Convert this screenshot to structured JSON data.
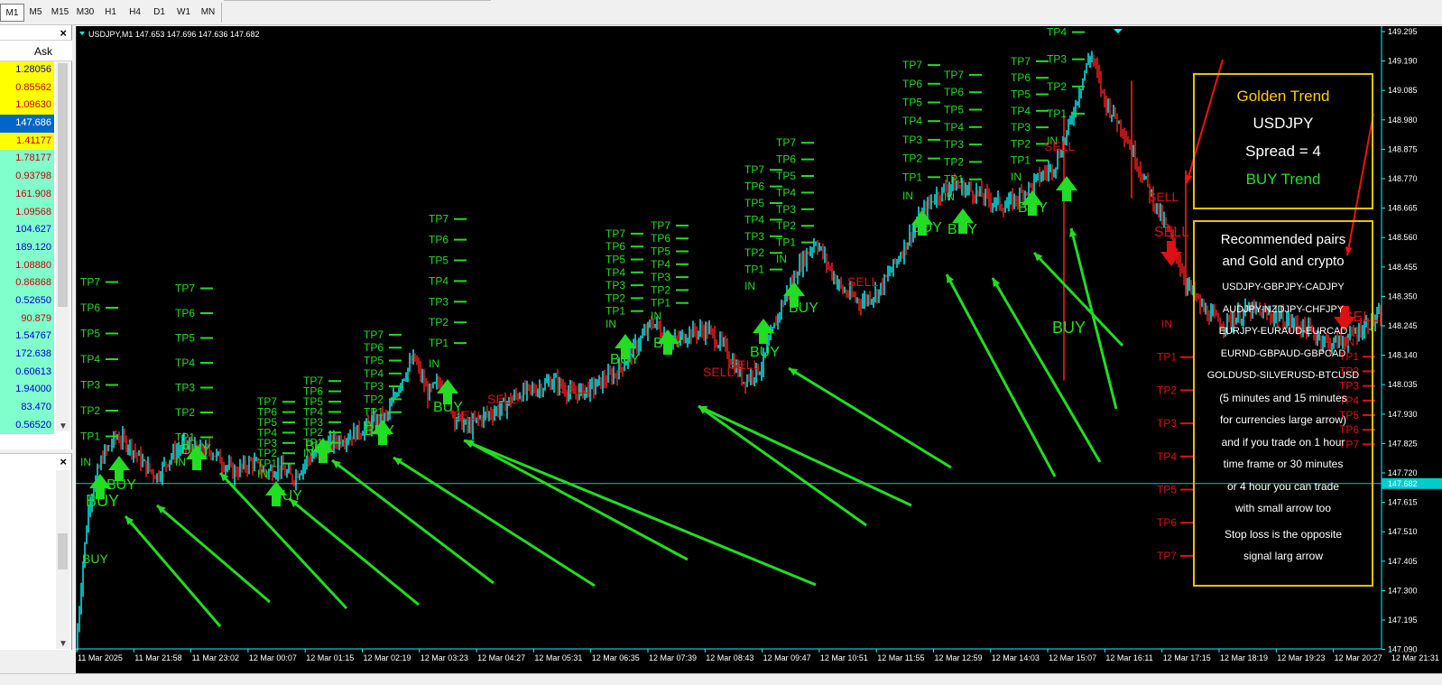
{
  "toolbar": {
    "timeframes": [
      "M1",
      "M5",
      "M15",
      "M30",
      "H1",
      "H4",
      "D1",
      "W1",
      "MN"
    ],
    "active": "M1"
  },
  "market_watch": {
    "column_header": "Ask",
    "rows": [
      {
        "ask": "1.28056",
        "bg": "#ffff00",
        "fg": "#0000c8"
      },
      {
        "ask": "0.85562",
        "bg": "#ffff00",
        "fg": "#c80000"
      },
      {
        "ask": "1.09630",
        "bg": "#ffff00",
        "fg": "#c80000"
      },
      {
        "ask": "147.686",
        "bg": "#0066cc",
        "fg": "#ffffff"
      },
      {
        "ask": "1.41177",
        "bg": "#ffff00",
        "fg": "#c80000"
      },
      {
        "ask": "1.78177",
        "bg": "#80ffcc",
        "fg": "#c80000"
      },
      {
        "ask": "0.93798",
        "bg": "#80ffcc",
        "fg": "#c80000"
      },
      {
        "ask": "161.908",
        "bg": "#80ffcc",
        "fg": "#c80000"
      },
      {
        "ask": "1.09568",
        "bg": "#80ffcc",
        "fg": "#c80000"
      },
      {
        "ask": "104.627",
        "bg": "#80ffcc",
        "fg": "#0000c8"
      },
      {
        "ask": "189.120",
        "bg": "#80ffcc",
        "fg": "#0000c8"
      },
      {
        "ask": "1.08880",
        "bg": "#80ffcc",
        "fg": "#c80000"
      },
      {
        "ask": "0.86868",
        "bg": "#80ffcc",
        "fg": "#c80000"
      },
      {
        "ask": "0.52650",
        "bg": "#80ffcc",
        "fg": "#0000c8"
      },
      {
        "ask": "90.879",
        "bg": "#80ffcc",
        "fg": "#c80000"
      },
      {
        "ask": "1.54767",
        "bg": "#80ffcc",
        "fg": "#0000c8"
      },
      {
        "ask": "172.638",
        "bg": "#80ffcc",
        "fg": "#0000c8"
      },
      {
        "ask": "0.60613",
        "bg": "#80ffcc",
        "fg": "#0000c8"
      },
      {
        "ask": "1.94000",
        "bg": "#80ffcc",
        "fg": "#0000c8"
      },
      {
        "ask": "83.470",
        "bg": "#80ffcc",
        "fg": "#0000c8"
      },
      {
        "ask": "0.56520",
        "bg": "#80ffcc",
        "fg": "#0000c8"
      }
    ]
  },
  "chart": {
    "header": "USDJPY,M1  147.653 147.696 147.636 147.682",
    "current_price": "147.682",
    "price_ticks": [
      "149.295",
      "149.190",
      "149.085",
      "148.980",
      "148.875",
      "148.770",
      "148.665",
      "148.560",
      "148.455",
      "148.350",
      "148.245",
      "148.140",
      "148.035",
      "147.930",
      "147.825",
      "147.720",
      "147.615",
      "147.510",
      "147.405",
      "147.300",
      "147.195",
      "147.090"
    ],
    "time_ticks": [
      "11 Mar 2025",
      "11 Mar 21:58",
      "11 Mar 23:02",
      "12 Mar 00:07",
      "12 Mar 01:15",
      "12 Mar 02:19",
      "12 Mar 03:23",
      "12 Mar 04:27",
      "12 Mar 05:31",
      "12 Mar 06:35",
      "12 Mar 07:39",
      "12 Mar 08:43",
      "12 Mar 09:47",
      "12 Mar 10:51",
      "12 Mar 11:55",
      "12 Mar 12:59",
      "12 Mar 14:03",
      "12 Mar 15:07",
      "12 Mar 16:11",
      "12 Mar 17:15",
      "12 Mar 18:19",
      "12 Mar 19:23",
      "12 Mar 20:27",
      "12 Mar 21:31"
    ],
    "signal_labels": {
      "buy": "BUY",
      "sell": "SELL",
      "entry": "IN",
      "tp": [
        "TP1",
        "TP2",
        "TP3",
        "TP4",
        "TP5",
        "TP6",
        "TP7"
      ]
    },
    "colors": {
      "buy": "#22dd22",
      "sell": "#dd1111",
      "candle_up": "#00ffff",
      "candle_down": "#ff2020",
      "axis": "#00ffff"
    }
  },
  "info_box": {
    "title": "Golden Trend",
    "symbol": "USDJPY",
    "spread": "Spread = 4",
    "trend": "BUY Trend"
  },
  "recommend_box": {
    "heading1": "Recommended pairs",
    "heading2": "and Gold and crypto",
    "pairs": [
      "USDJPY-GBPJPY-CADJPY",
      "AUDJPY-NZDJPY-CHFJPY",
      "EURJPY-EURAUD-EURCAD",
      "EURND-GBPAUD-GBPCAD",
      "GOLDUSD-SILVERUSD-BTCUSD"
    ],
    "notes": [
      "(5 minutes and 15 minutes",
      "for currencies large arrow)",
      "and if you trade on 1 hour",
      "time frame or 30 minutes",
      "or 4 hour you can trade",
      "with small arrow too",
      "Stop loss is the opposite",
      "signal larg arrow"
    ]
  }
}
